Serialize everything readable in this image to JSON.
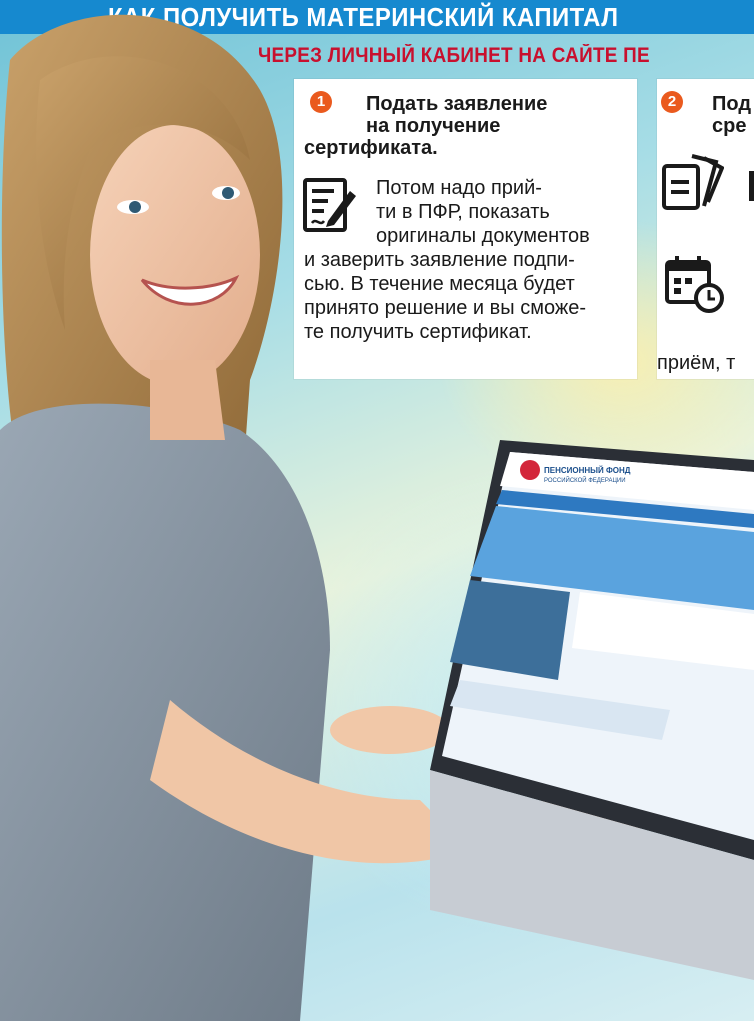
{
  "header": {
    "title": "КАК ПОЛУЧИТЬ МАТЕРИНСКИЙ КАПИТАЛ",
    "subtitle": "ЧЕРЕЗ ЛИЧНЫЙ КАБИНЕТ НА САЙТЕ ПЕ"
  },
  "steps": [
    {
      "number": "1",
      "title_lines": [
        "Подать заявление",
        "на получение",
        "сертификата."
      ],
      "body_lines": [
        "Потом надо прий-",
        "ти в ПФР, показать",
        "оригиналы документов",
        "и заверить заявление подпи-",
        "сью. В течение месяца будет",
        "принято решение и вы сможе-",
        "те  получить сертификат."
      ],
      "icon": "document-sign-icon"
    },
    {
      "number": "2",
      "title_lines": [
        "Под",
        "сре"
      ],
      "tail_text": "приём, т",
      "icons": [
        "documents-icon",
        "calendar-clock-icon"
      ]
    }
  ],
  "laptop_screen": {
    "site_name_line1": "ПЕНСИОННЫЙ ФОНД",
    "site_name_line2": "РОССИЙСКОЙ ФЕДЕРАЦИИ"
  },
  "colors": {
    "banner": "#1689cf",
    "subtitle": "#c8102e",
    "step_badge": "#ea5a1e"
  }
}
